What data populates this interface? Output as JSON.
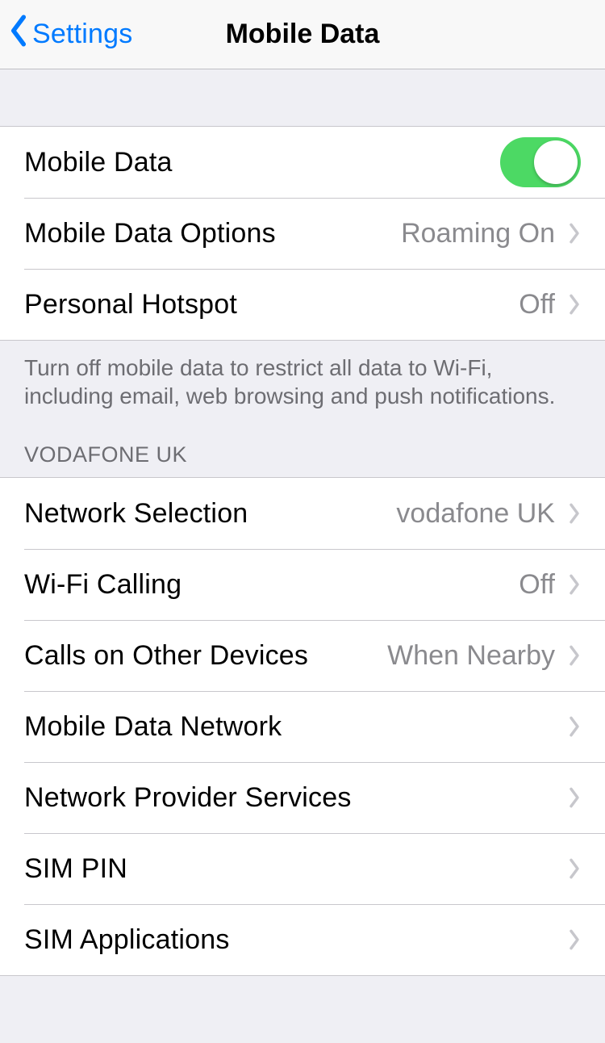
{
  "nav": {
    "back_label": "Settings",
    "title": "Mobile Data"
  },
  "group1": {
    "mobile_data": "Mobile Data",
    "mobile_data_on": true,
    "options_label": "Mobile Data Options",
    "options_value": "Roaming On",
    "hotspot_label": "Personal Hotspot",
    "hotspot_value": "Off",
    "footer": "Turn off mobile data to restrict all data to Wi-Fi, including email, web browsing and push notifications."
  },
  "carrier_header": "VODAFONE UK",
  "group2": {
    "network_selection_label": "Network Selection",
    "network_selection_value": "vodafone UK",
    "wifi_calling_label": "Wi-Fi Calling",
    "wifi_calling_value": "Off",
    "calls_other_label": "Calls on Other Devices",
    "calls_other_value": "When Nearby",
    "mobile_data_network_label": "Mobile Data Network",
    "provider_services_label": "Network Provider Services",
    "sim_pin_label": "SIM PIN",
    "sim_apps_label": "SIM Applications"
  }
}
